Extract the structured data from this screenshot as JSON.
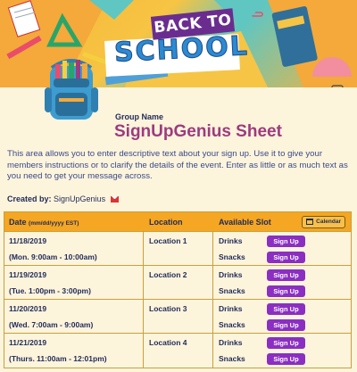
{
  "banner": {
    "line1": "BACK TO",
    "line2": "SCHOOL"
  },
  "header": {
    "group_label": "Group Name",
    "title": "SignUpGenius Sheet",
    "description": "This area allows you to enter descriptive text about your sign up. Use it to give your members instructions or to clarify the details of the event. Enter as little or as much text as you need to get your message across.",
    "created_by_label": "Created by:",
    "created_by_name": "SignUpGenius"
  },
  "table": {
    "col_date": "Date",
    "col_date_format": "(mm/dd/yyyy EST)",
    "col_location": "Location",
    "col_slot": "Available Slot",
    "calendar_button": "Calendar",
    "rows": [
      {
        "date": "11/18/2019",
        "time": "(Mon. 9:00am - 10:00am)",
        "location": "Location 1",
        "slots": [
          {
            "name": "Drinks",
            "action": "Sign Up"
          },
          {
            "name": "Snacks",
            "action": "Sign Up"
          }
        ]
      },
      {
        "date": "11/19/2019",
        "time": "(Tue. 1:00pm - 3:00pm)",
        "location": "Location 2",
        "slots": [
          {
            "name": "Drinks",
            "action": "Sign Up"
          },
          {
            "name": "Snacks",
            "action": "Sign Up"
          }
        ]
      },
      {
        "date": "11/20/2019",
        "time": "(Wed. 7:00am - 9:00am)",
        "location": "Location 3",
        "slots": [
          {
            "name": "Drinks",
            "action": "Sign Up"
          },
          {
            "name": "Snacks",
            "action": "Sign Up"
          }
        ]
      },
      {
        "date": "11/21/2019",
        "time": "(Thurs. 11:00am - 12:01pm)",
        "location": "Location 4",
        "slots": [
          {
            "name": "Drinks",
            "action": "Sign Up"
          },
          {
            "name": "Snacks",
            "action": "Sign Up"
          }
        ]
      }
    ]
  },
  "colors": {
    "header_orange": "#f5a623",
    "title_magenta": "#9c3b7f",
    "signup_purple": "#8a2fc1",
    "page_bg": "#fdf4dc"
  }
}
